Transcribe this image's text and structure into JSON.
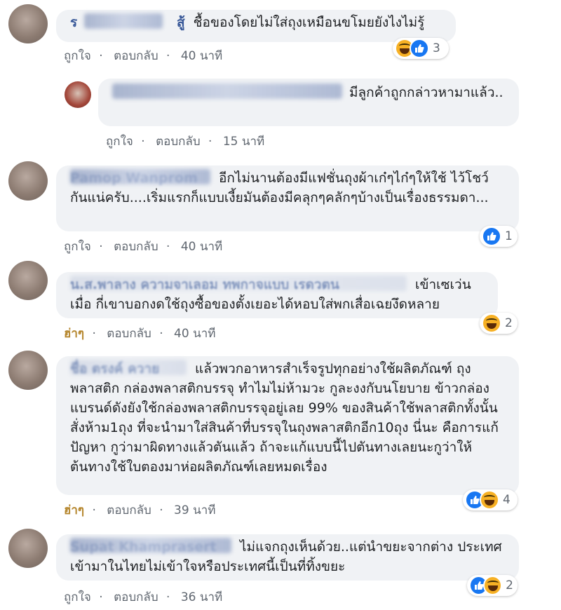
{
  "comments": [
    {
      "id": "c1",
      "name": "ร",
      "name_tail": "สู้",
      "text": "ชื้อของโดยไม่ใส่ถุงเหมือนขโมยยังไงไม่รู้",
      "like_label": "ถูกใจ",
      "reply_label": "ตอบกลับ",
      "dot": "·",
      "time": "40 นาที",
      "reaction_count": "3",
      "reactions": [
        "haha-icon",
        "like-icon"
      ]
    },
    {
      "id": "c1r",
      "text": "มีลูกค้าถูกกล่าวหามาแล้ว..",
      "like_label": "ถูกใจ",
      "reply_label": "ตอบกลับ",
      "dot": "·",
      "time": "15 นาที"
    },
    {
      "id": "c2",
      "name": "Pamop Wanprom",
      "text_line1": "อีกไม่นานต้องมีแฟชั่นถุงผ้าเก๋ๆไก๋ๆให้ใช้",
      "text_rest": "ไว้โชว์กันแน่ครับ....เริ่มแรกก็แบบเงี้ยมันต้องมีคลุกๆคลักๆบ้างเป็นเรื่องธรรมดา...",
      "like_label": "ถูกใจ",
      "reply_label": "ตอบกลับ",
      "dot": "·",
      "time": "40 นาที",
      "reaction_count": "1",
      "reactions": [
        "like-icon"
      ]
    },
    {
      "id": "c3",
      "name": "น.ส.พาลาง ความจาเลอม ทพกาจแบบ เรดวตน",
      "text_line1": "เข้าเซเว่นเมื่อ",
      "text_rest": "กี่เขาบอกงดใช้ถุงซื้อของตั้งเยอะได้หอบใส่พกเสื่อเฉยงึดหลาย",
      "like_label": "ฮ่าๆ",
      "reply_label": "ตอบกลับ",
      "dot": "·",
      "time": "40 นาที",
      "reaction_count": "2",
      "reactions": [
        "haha-icon"
      ]
    },
    {
      "id": "c4",
      "name": "ชื่อ ตรงค์ ควาย",
      "text_line1": "แล้วพวกอาหารสำเร็จรูปทุกอย่างใช้ผลิตภัณฑ์",
      "text_rest": "ถุงพลาสติก กล่องพลาสติกบรรจุ ทำไมไม่ห้ามวะ กูละงงกับนโยบาย ข้าวกล่องแบรนด์ดังยังใช้กล่องพลาสติกบรรจุอยู่เลย 99% ของสินค้าใช้พลาสติกทั้งนั้น สั่งห้าม1ถุง ที่จะนำมาใส่สินค้าที่บรรจุในถุงพลาสติกอีก10ถุง นี่นะ คือการแก้ปัญหา กูว่ามาผิดทางแล้วตันแล้ว ถ้าจะแก้แบบนี้ไปตันทางเลยนะกูว่าให้ต้นทางใช้ใบตองมาห่อผลิตภัณฑ์เลยหมดเรื่อง",
      "like_label": "ฮ่าๆ",
      "reply_label": "ตอบกลับ",
      "dot": "·",
      "time": "39 นาที",
      "reaction_count": "4",
      "reactions": [
        "like-icon",
        "haha-icon"
      ]
    },
    {
      "id": "c5",
      "name": "Supat Khamprasert",
      "text_line1": "ไม่แจกถุงเห็นด้วย..แต่นำขยะจากต่าง",
      "text_rest": "ประเทศเข้ามาในไทยไม่เข้าใจหรือประเทศนี้เป็นที่ทิ้งขยะ",
      "like_label": "ถูกใจ",
      "reply_label": "ตอบกลับ",
      "dot": "·",
      "time": "36 นาที",
      "reaction_count": "2",
      "reactions": [
        "like-icon",
        "haha-icon"
      ]
    }
  ],
  "colors": {
    "bubble": "#f0f2f5",
    "name": "#385898",
    "meta": "#606770",
    "haha_label": "#b5862d",
    "like_blue": "#1877f2",
    "haha_yellow": "#f7b125"
  }
}
